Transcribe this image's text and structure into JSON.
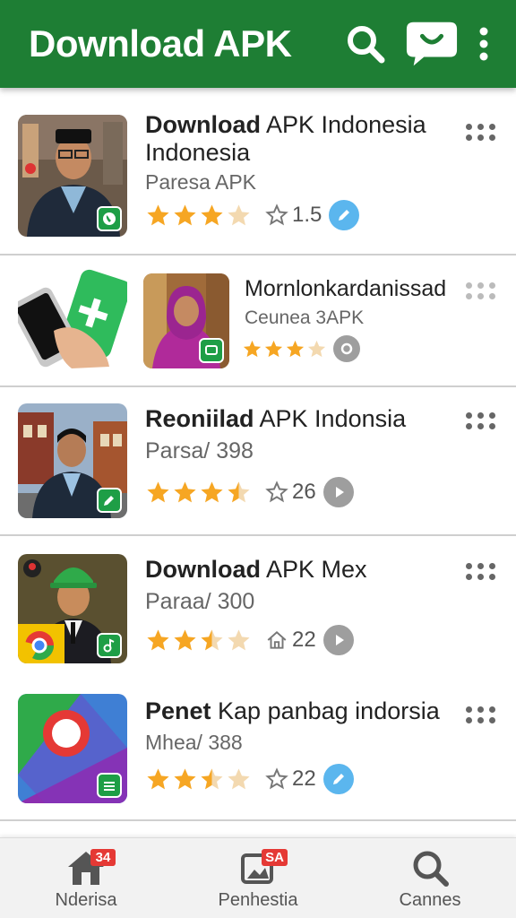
{
  "appbar": {
    "title": "Download APK",
    "color": "#1e7e34",
    "icons": [
      "search-icon",
      "chat-icon",
      "more-vert-icon"
    ]
  },
  "apps": [
    {
      "title_bold": "Download",
      "title_rest": " APK Indonesia",
      "title_line2": "Indonesia",
      "subtitle": "Paresa APK",
      "rating_stars": 3,
      "rating_count": "1.5",
      "meta_icon": "star-outline-icon",
      "action": "edit-icon"
    },
    {
      "title_bold": "",
      "title_rest": "Mornlonkardanissad",
      "title_line2": "",
      "subtitle": "Ceunea 3APK",
      "rating_stars": 3,
      "rating_count": "",
      "meta_icon": "",
      "action": "app-icon"
    },
    {
      "title_bold": "Reoniilad",
      "title_rest": " APK Indonsia",
      "title_line2": "",
      "subtitle": "Parsa/ 398",
      "rating_stars": 3.5,
      "rating_count": "26",
      "meta_icon": "star-outline-icon",
      "action": "play-icon"
    },
    {
      "title_bold": "Download",
      "title_rest": " APK Mex",
      "title_line2": "",
      "subtitle": "Paraa/ 300",
      "rating_stars": 2.5,
      "rating_count": "22",
      "meta_icon": "home-icon",
      "action": "play-icon"
    },
    {
      "title_bold": "Penet",
      "title_rest": " Kap panbag indorsia",
      "title_line2": "",
      "subtitle": "Mhea/ 388",
      "rating_stars": 2.5,
      "rating_count": "22",
      "meta_icon": "star-outline-icon",
      "action": "edit-icon"
    }
  ],
  "bottom_nav": [
    {
      "label": "Nderisa",
      "icon": "home-icon",
      "badge": "34"
    },
    {
      "label": "Penhestia",
      "icon": "photo-icon",
      "badge": "SA"
    },
    {
      "label": "Cannes",
      "icon": "search-icon",
      "badge": ""
    }
  ],
  "colors": {
    "star": "#f6a623",
    "star_empty": "#f3d9b0",
    "accent_blue": "#5bb6ee"
  }
}
